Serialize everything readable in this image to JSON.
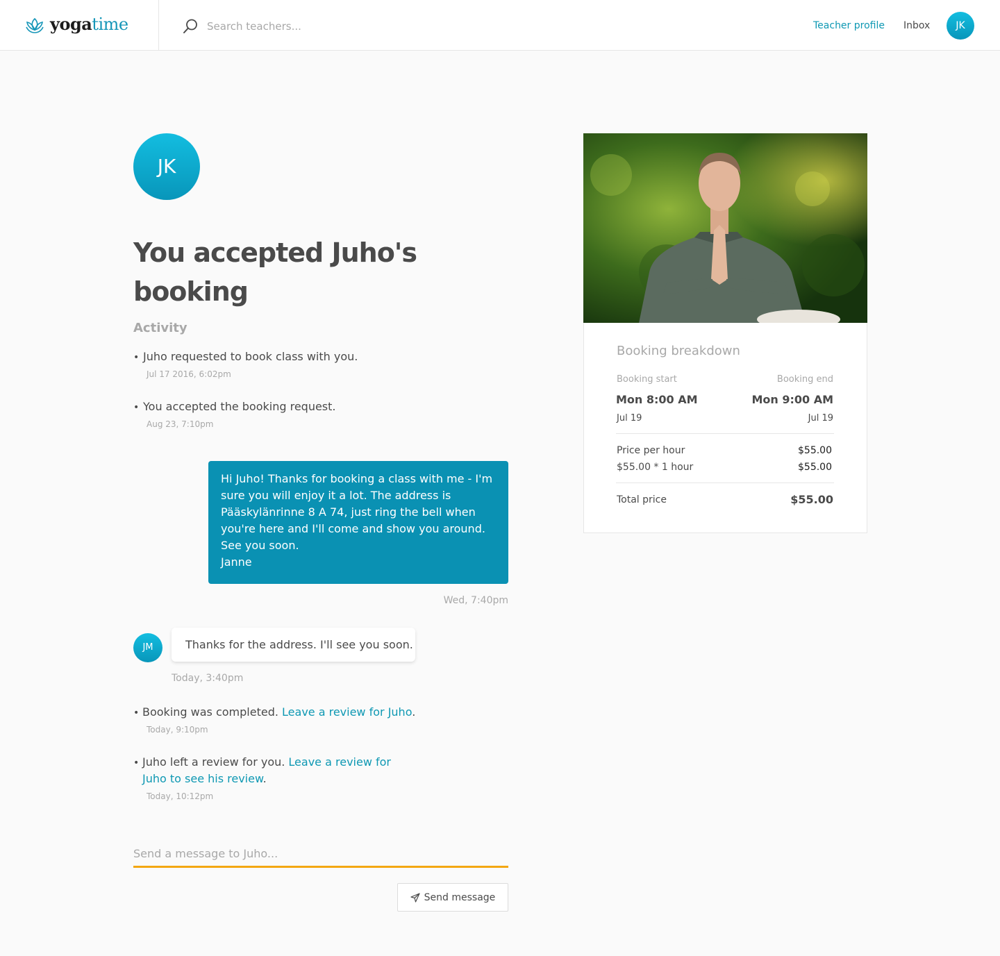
{
  "header": {
    "logo": {
      "part1": "yoga",
      "part2": "time"
    },
    "search": {
      "placeholder": "Search teachers..."
    },
    "nav": {
      "teacher_profile": "Teacher profile",
      "inbox": "Inbox"
    },
    "user_initials": "JK",
    "accent": "#0e98b3"
  },
  "profile": {
    "initials": "JK"
  },
  "title": "You accepted Juho's booking",
  "activity": {
    "heading": "Activity",
    "events": [
      {
        "text": "Juho requested to book class with you.",
        "time": "Jul 17 2016, 6:02pm"
      },
      {
        "text": "You accepted the booking request.",
        "time": "Aug 23, 7:10pm"
      }
    ]
  },
  "messages": {
    "own": {
      "text": "Hi Juho! Thanks for booking a class with me - I'm sure you will enjoy it a lot. The address is Pääskylänrinne 8 A 74, just ring the bell when you're here and I'll come and show you around. See you soon.\nJanne",
      "time": "Wed, 7:40pm"
    },
    "other": {
      "initials": "JM",
      "text": "Thanks for the address. I'll see you soon.",
      "time": "Today, 3:40pm"
    }
  },
  "later_events": [
    {
      "text": "Booking was completed. ",
      "link": "Leave a review for Juho",
      "after": ".",
      "time": "Today, 9:10pm"
    },
    {
      "text": "Juho left a review for you. ",
      "link": "Leave a review for Juho to see his review",
      "after": ".",
      "time": "Today, 10:12pm"
    }
  ],
  "composer": {
    "placeholder": "Send a message to Juho...",
    "send_label": "Send message",
    "underline_color": "#f3a712"
  },
  "breakdown": {
    "title": "Booking breakdown",
    "start_label": "Booking start",
    "end_label": "Booking end",
    "start_time": "Mon 8:00 AM",
    "end_time": "Mon 9:00 AM",
    "start_date": "Jul 19",
    "end_date": "Jul 19",
    "price_per_hour_label": "Price per hour",
    "price_per_hour_value": "$55.00",
    "calc_label": "$55.00 * 1 hour",
    "calc_value": "$55.00",
    "total_label": "Total price",
    "total_value": "$55.00"
  }
}
